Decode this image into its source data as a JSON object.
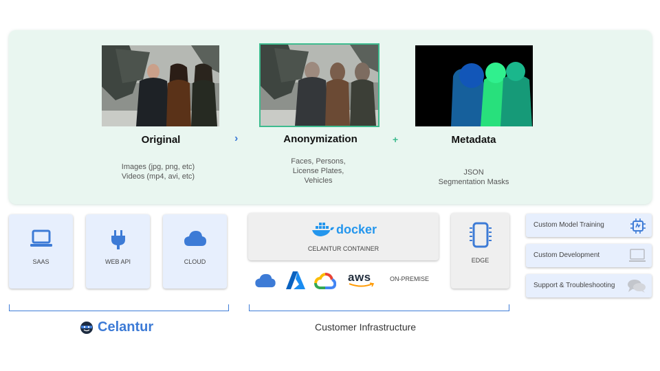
{
  "stages": [
    {
      "title": "Original",
      "description": [
        "Images (jpg, png, etc)",
        "Videos (mp4, avi, etc)"
      ]
    },
    {
      "title": "Anonymization",
      "description": [
        "Faces, Persons,",
        "License Plates,",
        "Vehicles"
      ]
    },
    {
      "title": "Metadata",
      "description": [
        "JSON",
        "Segmentation Masks"
      ]
    }
  ],
  "connectors": {
    "arrow": "›",
    "plus": "+"
  },
  "celantur_cards": [
    {
      "label": "SAAS",
      "icon": "laptop-icon"
    },
    {
      "label": "WEB API",
      "icon": "plug-icon"
    },
    {
      "label": "CLOUD",
      "icon": "cloud-icon"
    }
  ],
  "container": {
    "brand": "docker",
    "label": "CELANTUR CONTAINER"
  },
  "edge": {
    "label": "EDGE",
    "icon": "chip-icon"
  },
  "providers": {
    "aws_text": "aws",
    "on_premise": "ON-PREMISE"
  },
  "services": [
    {
      "label": "Custom Model Training",
      "icon": "processor-icon"
    },
    {
      "label": "Custom Development",
      "icon": "monitor-icon"
    },
    {
      "label": "Support & Troubleshooting",
      "icon": "chat-icon"
    }
  ],
  "footer": {
    "celantur_logo_text": "Celantur",
    "customer_label": "Customer Infrastructure"
  },
  "colors": {
    "accent_blue": "#3d7bd6",
    "accent_green": "#3dbb8e",
    "panel_bg": "#e9f6f0",
    "card_bg": "#e7effd"
  }
}
